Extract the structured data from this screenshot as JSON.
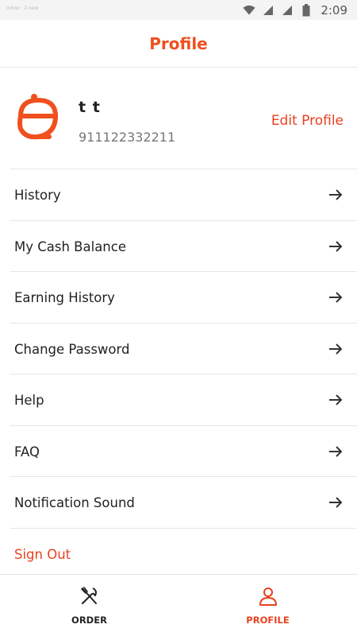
{
  "status_bar": {
    "notification_text": "Inbox · 2 new",
    "time": "2:09",
    "icons": [
      "wifi-icon",
      "signal-icon",
      "signal-icon",
      "battery-icon"
    ]
  },
  "header": {
    "title": "Profile"
  },
  "profile": {
    "name": "t t",
    "phone": "911122332211",
    "edit_label": "Edit Profile",
    "avatar_icon": "cloche-e-logo-icon"
  },
  "menu": {
    "items": [
      {
        "label": "History",
        "icon": "arrow-right-icon"
      },
      {
        "label": "My Cash Balance",
        "icon": "arrow-right-icon"
      },
      {
        "label": "Earning History",
        "icon": "arrow-right-icon"
      },
      {
        "label": "Change Password",
        "icon": "arrow-right-icon"
      },
      {
        "label": "Help",
        "icon": "arrow-right-icon"
      },
      {
        "label": "FAQ",
        "icon": "arrow-right-icon"
      },
      {
        "label": "Notification Sound",
        "icon": "arrow-right-icon"
      }
    ],
    "sign_out": "Sign Out"
  },
  "bottom_nav": {
    "tabs": [
      {
        "label": "ORDER",
        "icon": "fork-knife-icon",
        "active": false
      },
      {
        "label": "PROFILE",
        "icon": "user-icon",
        "active": true
      }
    ]
  },
  "colors": {
    "accent": "#E8411E",
    "text": "#222222",
    "muted": "#777777",
    "divider": "#E6E6E6"
  }
}
